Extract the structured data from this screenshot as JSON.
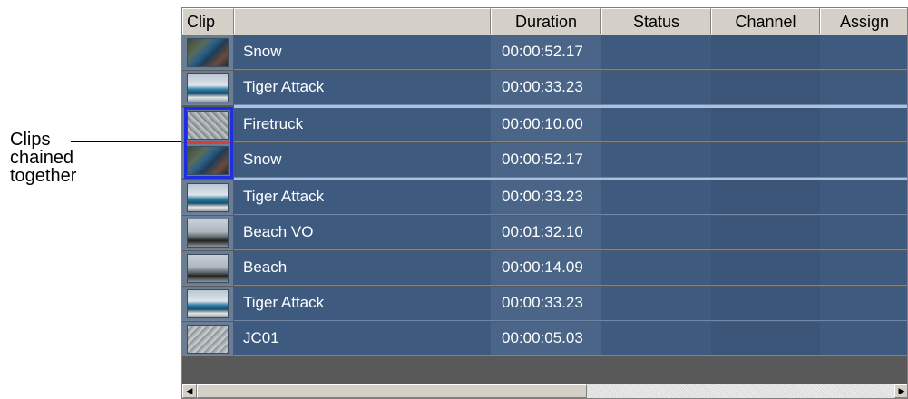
{
  "callout": {
    "lines": [
      "Clips",
      "chained",
      "together"
    ]
  },
  "table": {
    "columns": [
      "Clip",
      "",
      "Duration",
      "Status",
      "Channel",
      "Assign"
    ],
    "rows": [
      {
        "name": "Snow",
        "duration": "00:00:52.17",
        "status": "",
        "channel": "",
        "assign": "",
        "thumb": "snow-thumbnail"
      },
      {
        "name": "Tiger Attack",
        "duration": "00:00:33.23",
        "status": "",
        "channel": "",
        "assign": "",
        "thumb": "tiger-thumbnail"
      },
      {
        "name": "Firetruck",
        "duration": "00:00:10.00",
        "status": "",
        "channel": "",
        "assign": "",
        "thumb": "fire-thumbnail"
      },
      {
        "name": "Snow",
        "duration": "00:00:52.17",
        "status": "",
        "channel": "",
        "assign": "",
        "thumb": "snow-thumbnail"
      },
      {
        "name": "Tiger Attack",
        "duration": "00:00:33.23",
        "status": "",
        "channel": "",
        "assign": "",
        "thumb": "tiger-thumbnail"
      },
      {
        "name": "Beach VO",
        "duration": "00:01:32.10",
        "status": "",
        "channel": "",
        "assign": "",
        "thumb": "beach-thumbnail"
      },
      {
        "name": "Beach",
        "duration": "00:00:14.09",
        "status": "",
        "channel": "",
        "assign": "",
        "thumb": "beach-thumbnail"
      },
      {
        "name": "Tiger Attack",
        "duration": "00:00:33.23",
        "status": "",
        "channel": "",
        "assign": "",
        "thumb": "tiger-thumbnail"
      },
      {
        "name": "JC01",
        "duration": "00:00:05.03",
        "status": "",
        "channel": "",
        "assign": "",
        "thumb": "jc-thumbnail"
      }
    ]
  },
  "scrollbar": {
    "left_icon": "◀",
    "right_icon": "▶"
  },
  "colors": {
    "row_bg": "#3e5a7f",
    "chain_border": "#1f2fe0",
    "chain_join": "#e03a3a"
  }
}
